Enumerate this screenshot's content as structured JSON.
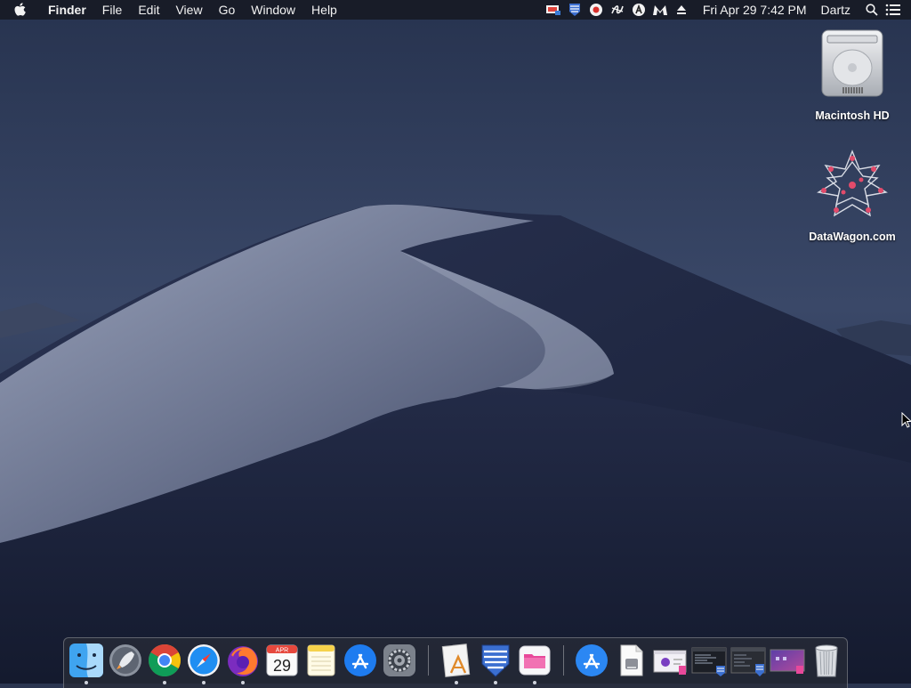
{
  "menubar": {
    "app_name": "Finder",
    "menus": [
      "File",
      "Edit",
      "View",
      "Go",
      "Window",
      "Help"
    ],
    "clock": "Fri Apr 29  7:42 PM",
    "user": "Dartz"
  },
  "desktop": {
    "icons": [
      {
        "label": "Macintosh HD",
        "icon": "hard-drive-icon"
      },
      {
        "label": "DataWagon.com",
        "icon": "datawagon-star-icon"
      }
    ]
  },
  "dock": {
    "calendar_month": "APR",
    "calendar_day": "29",
    "items": [
      "finder",
      "launchpad",
      "chrome",
      "safari",
      "firefox",
      "calendar",
      "notes",
      "app-store",
      "system-preferences",
      "textedit-app",
      "striped-shield-app",
      "pink-folder-app",
      "app-store-2",
      "document-file",
      "purple-window",
      "terminal-window",
      "dark-window",
      "purple-gradient-window",
      "trash"
    ]
  },
  "colors": {
    "sky": "#2e3a5a",
    "dune_light": "#8e98b0",
    "dune_dark": "#1c2440"
  }
}
